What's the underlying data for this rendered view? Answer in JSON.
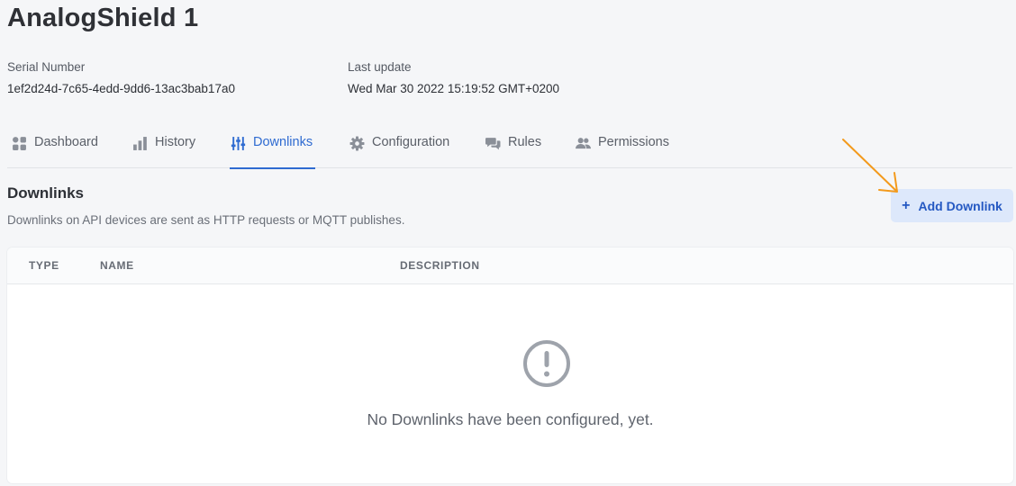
{
  "device": {
    "title": "AnalogShield 1"
  },
  "meta": {
    "serial_label": "Serial Number",
    "serial_value": "1ef2d24d-7c65-4edd-9dd6-13ac3bab17a0",
    "update_label": "Last update",
    "update_value": "Wed Mar 30 2022 15:19:52 GMT+0200"
  },
  "tabs": [
    {
      "label": "Dashboard",
      "icon": "dashboard-icon"
    },
    {
      "label": "History",
      "icon": "bar-chart-icon"
    },
    {
      "label": "Downlinks",
      "icon": "sliders-icon",
      "active": true
    },
    {
      "label": "Configuration",
      "icon": "gear-icon"
    },
    {
      "label": "Rules",
      "icon": "chat-bubbles-icon"
    },
    {
      "label": "Permissions",
      "icon": "users-icon"
    }
  ],
  "section": {
    "title": "Downlinks",
    "description": "Downlinks on API devices are sent as HTTP requests or MQTT publishes."
  },
  "actions": {
    "add_label": "Add Downlink"
  },
  "table": {
    "columns": [
      "TYPE",
      "NAME",
      "DESCRIPTION"
    ],
    "empty_message": "No Downlinks have been configured, yet."
  },
  "colors": {
    "accent": "#2f6bd1",
    "button_bg": "#dde8fb",
    "annotation_arrow": "#f39a1c"
  }
}
